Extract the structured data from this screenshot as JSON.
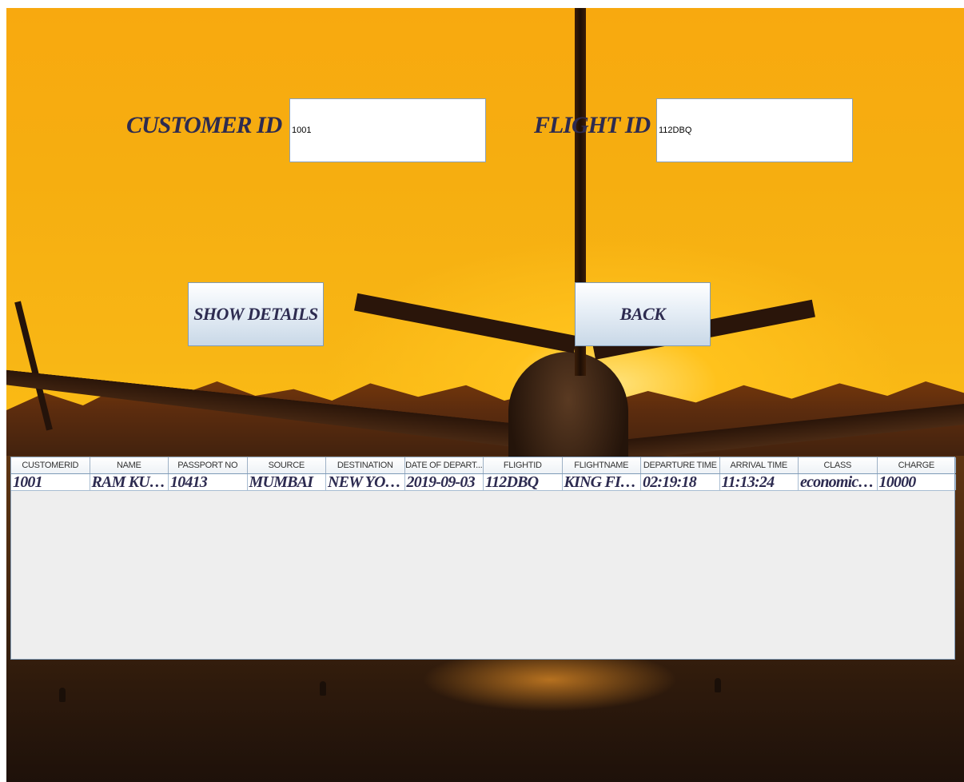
{
  "form": {
    "customer_id_label": "CUSTOMER ID",
    "customer_id_value": "1001",
    "flight_id_label": "FLIGHT ID",
    "flight_id_value": "112DBQ",
    "show_details_label": "SHOW DETAILS",
    "back_label": "BACK"
  },
  "table": {
    "headers": [
      "CUSTOMERID",
      "NAME",
      "PASSPORT NO",
      "SOURCE",
      "DESTINATION",
      "DATE OF DEPART...",
      "FLIGHTID",
      "FLIGHTNAME",
      "DEPARTURE TIME",
      "ARRIVAL TIME",
      "CLASS",
      "CHARGE"
    ],
    "rows": [
      [
        "1001",
        "RAM KUM...",
        "10413",
        "MUMBAI",
        "NEW YORK",
        "2019-09-03",
        "112DBQ",
        "KING FISH",
        "02:19:18",
        "11:13:24",
        "economiccl...",
        "10000"
      ]
    ]
  },
  "colors": {
    "label_text": "#2d2b50",
    "sky": "#f8b615",
    "table_border": "#7f9bb8"
  }
}
